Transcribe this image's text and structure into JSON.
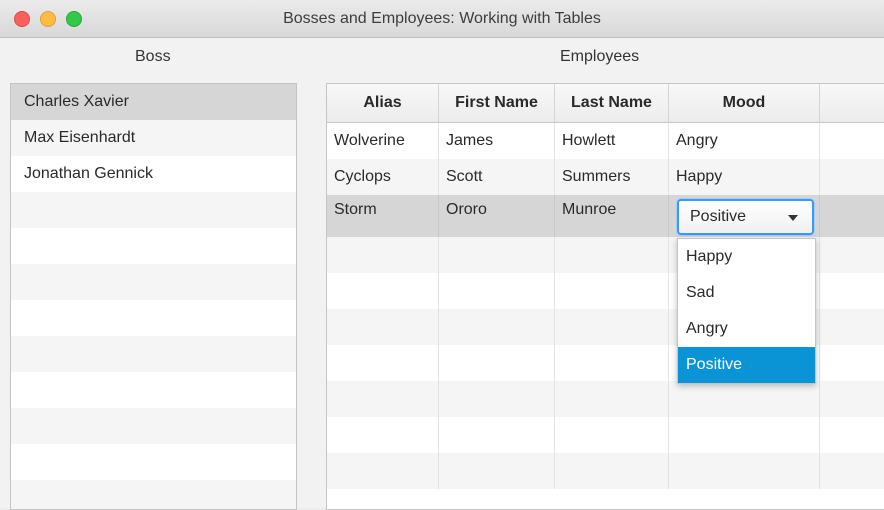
{
  "window": {
    "title": "Bosses and Employees: Working with Tables"
  },
  "boss_panel": {
    "label": "Boss",
    "items": [
      {
        "name": "Charles Xavier",
        "selected": true
      },
      {
        "name": "Max Eisenhardt",
        "selected": false
      },
      {
        "name": "Jonathan Gennick",
        "selected": false
      }
    ]
  },
  "employee_panel": {
    "label": "Employees",
    "columns": [
      "Alias",
      "First Name",
      "Last Name",
      "Mood",
      ""
    ],
    "rows": [
      {
        "alias": "Wolverine",
        "first_name": "James",
        "last_name": "Howlett",
        "mood": "Angry"
      },
      {
        "alias": "Cyclops",
        "first_name": "Scott",
        "last_name": "Summers",
        "mood": "Happy"
      },
      {
        "alias": "Storm",
        "first_name": "Ororo",
        "last_name": "Munroe",
        "mood": "Positive",
        "selected": true
      }
    ],
    "mood_editor": {
      "value": "Positive",
      "options": [
        "Happy",
        "Sad",
        "Angry",
        "Positive"
      ],
      "highlighted": "Positive"
    }
  },
  "colors": {
    "accent": "#0a94d6",
    "focus_ring": "#3b99fc",
    "selection": "#d6d6d6"
  }
}
